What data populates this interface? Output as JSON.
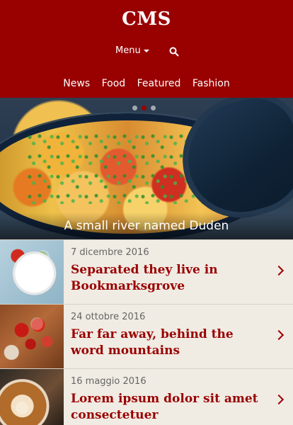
{
  "header": {
    "brand": "CMS",
    "menu_label": "Menu",
    "nav_items": [
      "News",
      "Food",
      "Featured",
      "Fashion"
    ]
  },
  "hero": {
    "caption": "A small river named Duden",
    "slides": 3,
    "active_slide": 2
  },
  "articles": [
    {
      "date": "7 dicembre 2016",
      "title": "Separated they live in Bookmarksgrove",
      "thumb": "salad"
    },
    {
      "date": "24 ottobre 2016",
      "title": "Far far away, behind the word mountains",
      "thumb": "tomatoes"
    },
    {
      "date": "16 maggio 2016",
      "title": "Lorem ipsum dolor sit amet consectetuer",
      "thumb": "coffee"
    }
  ],
  "colors": {
    "brand_red": "#990000",
    "background": "#f0ebe3"
  },
  "icons": {
    "search": "search-icon",
    "menu_caret": "chevron-down-icon",
    "article_arrow": "chevron-right-icon"
  }
}
